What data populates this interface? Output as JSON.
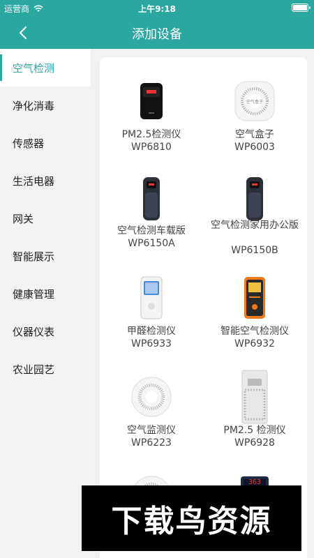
{
  "status_bar": {
    "carrier": "运营商",
    "time": "上午9:18"
  },
  "header": {
    "title": "添加设备"
  },
  "sidebar": {
    "items": [
      {
        "label": "空气检测",
        "active": true
      },
      {
        "label": "净化消毒"
      },
      {
        "label": "传感器"
      },
      {
        "label": "生活电器"
      },
      {
        "label": "网关"
      },
      {
        "label": "智能展示"
      },
      {
        "label": "健康管理"
      },
      {
        "label": "仪器仪表"
      },
      {
        "label": "农业园艺"
      }
    ]
  },
  "products": [
    {
      "name": "PM2.5检测仪",
      "model": "WP6810",
      "icon": "black-pm25-monitor"
    },
    {
      "name": "空气盒子",
      "model": "WP6003",
      "icon": "white-round-air-box",
      "device_label": "空气盒子"
    },
    {
      "name": "空气检测车载版",
      "model": "WP6150A",
      "icon": "cylinder-car-detector"
    },
    {
      "name": "空气检测家用办公版",
      "model": "WP6150B",
      "icon": "cylinder-home-detector"
    },
    {
      "name": "甲醛检测仪",
      "model": "WP6933",
      "icon": "white-handheld-formaldehyde-meter"
    },
    {
      "name": "智能空气检测仪",
      "model": "WP6932",
      "icon": "orange-handheld-air-meter"
    },
    {
      "name": "空气监测仪",
      "model": "WP6223",
      "icon": "white-disc-air-monitor"
    },
    {
      "name": "PM2.5 检测仪",
      "model": "WP6928",
      "icon": "white-panel-pm25-monitor"
    }
  ],
  "partial_products": [
    {
      "icon": "white-disc-air-monitor"
    },
    {
      "icon": "dark-display-monitor",
      "display": "363"
    }
  ],
  "watermark": {
    "text": "下载鸟资源"
  },
  "colors": {
    "primary": "#2ba7a2",
    "background": "#f2f2f2",
    "card": "#ffffff"
  }
}
